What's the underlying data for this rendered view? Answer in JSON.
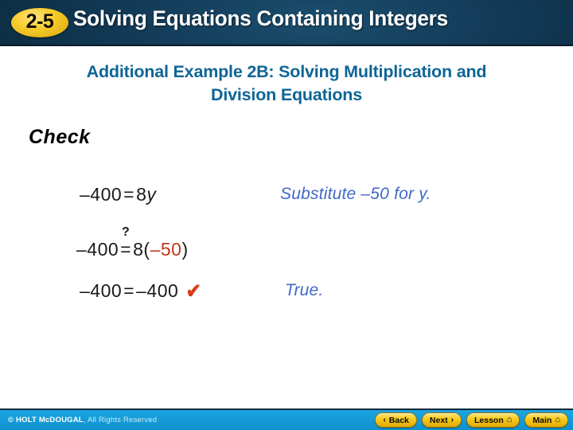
{
  "header": {
    "badge_label": "2-5",
    "title": "Solving Equations Containing Integers",
    "bg_color": "#0b2538",
    "badge_color": "#f2c51f"
  },
  "subtitle": {
    "line1": "Additional Example 2B: Solving Multiplication and",
    "line2": "Division Equations",
    "color": "#0e6596"
  },
  "body": {
    "section_heading": "Check",
    "steps": [
      {
        "left_a": "–400",
        "relation": "=",
        "relation_marker": "",
        "right_a": "8",
        "right_var": "y",
        "right_b": "",
        "checkmark": "",
        "note": "Substitute –50 for y."
      },
      {
        "left_a": "–400",
        "relation": "=",
        "relation_marker": "?",
        "right_a": "8(",
        "right_highlight": "–50",
        "right_b": ")",
        "checkmark": "",
        "note": ""
      },
      {
        "left_a": "–400",
        "relation": "=",
        "relation_marker": "",
        "right_a": "–400",
        "right_b": "",
        "checkmark": "✔",
        "note": "True."
      }
    ],
    "note_color": "#4169c8",
    "highlight_color": "#c0361c",
    "checkmark_color": "#d83c18"
  },
  "footer": {
    "copyright_strong": "© HOLT McDOUGAL",
    "copyright_light": ", All Rights Reserved",
    "bar_color": "#18a0db",
    "buttons": [
      {
        "label": "Back",
        "left_glyph": "‹",
        "right_glyph": "",
        "icon": "chevron-left-icon"
      },
      {
        "label": "Next",
        "left_glyph": "",
        "right_glyph": "›",
        "icon": "chevron-right-icon"
      },
      {
        "label": "Lesson",
        "left_glyph": "",
        "right_glyph": "⌂",
        "icon": "home-icon"
      },
      {
        "label": "Main",
        "left_glyph": "",
        "right_glyph": "⌂",
        "icon": "home-icon"
      }
    ]
  }
}
